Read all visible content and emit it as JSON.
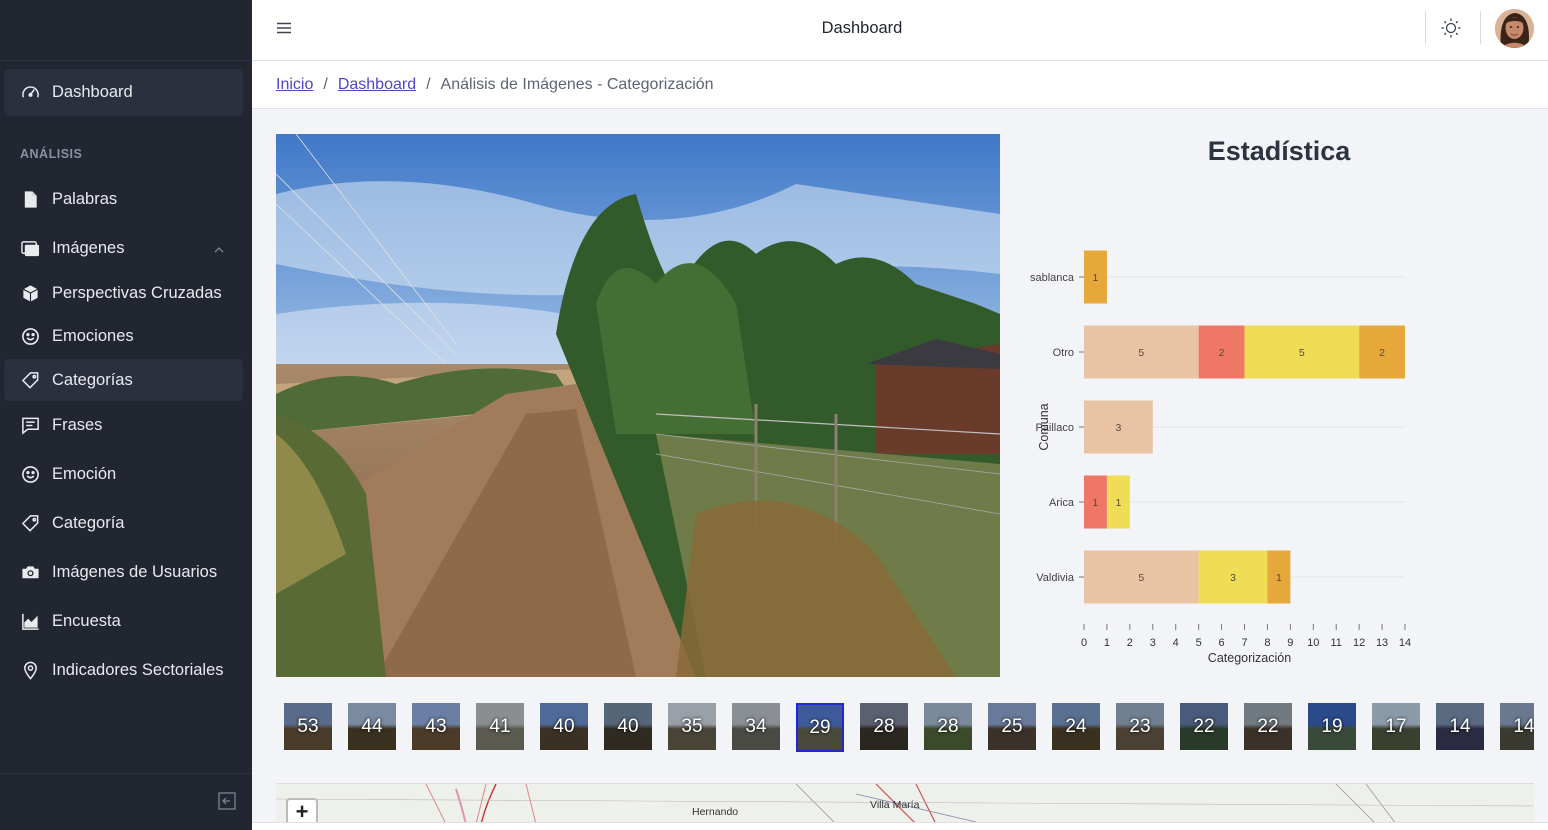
{
  "header": {
    "title": "Dashboard"
  },
  "sidebar": {
    "section_title": "ANÁLISIS",
    "items": [
      {
        "label": "Dashboard",
        "icon": "speedometer-icon"
      },
      {
        "label": "Palabras",
        "icon": "document-icon"
      },
      {
        "label": "Imágenes",
        "icon": "images-icon"
      },
      {
        "label": "Perspectivas Cruzadas",
        "icon": "cube-icon"
      },
      {
        "label": "Emociones",
        "icon": "smile-icon"
      },
      {
        "label": "Categorías",
        "icon": "tag-icon"
      },
      {
        "label": "Frases",
        "icon": "chat-icon"
      },
      {
        "label": "Emoción",
        "icon": "smile-icon"
      },
      {
        "label": "Categoría",
        "icon": "tag-icon"
      },
      {
        "label": "Imágenes de Usuarios",
        "icon": "camera-icon"
      },
      {
        "label": "Encuesta",
        "icon": "area-chart-icon"
      },
      {
        "label": "Indicadores Sectoriales",
        "icon": "map-pin-icon"
      }
    ]
  },
  "breadcrumb": {
    "home": "Inicio",
    "dashboard": "Dashboard",
    "current": "Análisis de Imágenes - Categorización"
  },
  "chart_title": "Estadística",
  "chart_data": {
    "type": "bar",
    "orientation": "horizontal",
    "stacked": true,
    "categories": [
      "sablanca",
      "Otro",
      "Paillaco",
      "Arica",
      "Valdivia"
    ],
    "category_labels_visible": [
      "sablanca",
      "Otro",
      "Paillaco",
      "Arica",
      "Valdivia"
    ],
    "series": [
      {
        "color": "#e8c4a4",
        "values": [
          0,
          5,
          3,
          0,
          5
        ]
      },
      {
        "color": "#ee7766",
        "values": [
          0,
          2,
          0,
          1,
          0
        ]
      },
      {
        "color": "#eedd55",
        "values": [
          0,
          5,
          0,
          1,
          3
        ]
      },
      {
        "color": "#e6a83a",
        "values": [
          1,
          2,
          0,
          0,
          1
        ]
      }
    ],
    "xlabel": "Categorización",
    "ylabel": "Comuna",
    "xlim": [
      0,
      14
    ],
    "xticks": [
      0,
      1,
      2,
      3,
      4,
      5,
      6,
      7,
      8,
      9,
      10,
      11,
      12,
      13,
      14
    ],
    "grid": true
  },
  "thumbnails": [
    "53",
    "44",
    "43",
    "41",
    "40",
    "40",
    "35",
    "34",
    "29",
    "28",
    "28",
    "25",
    "24",
    "23",
    "22",
    "22",
    "19",
    "17",
    "14",
    "14"
  ],
  "selected_thumbnail": 8,
  "map": {
    "zoom_in": "+",
    "labels": [
      "Hernando",
      "Villa María"
    ]
  }
}
